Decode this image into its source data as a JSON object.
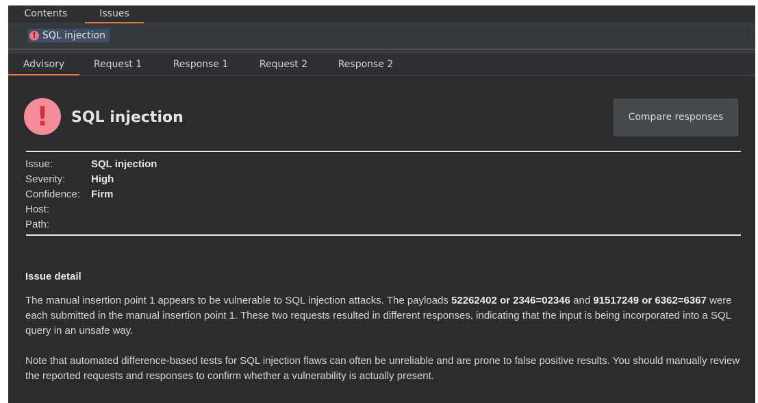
{
  "top_tabs": [
    {
      "label": "Contents",
      "active": false
    },
    {
      "label": "Issues",
      "active": true
    }
  ],
  "selected_issue": {
    "label": "SQL injection",
    "icon": "alert-icon"
  },
  "sub_tabs": [
    {
      "label": "Advisory",
      "active": true
    },
    {
      "label": "Request 1",
      "active": false
    },
    {
      "label": "Response 1",
      "active": false
    },
    {
      "label": "Request 2",
      "active": false
    },
    {
      "label": "Response 2",
      "active": false
    }
  ],
  "advisory": {
    "title": "SQL injection",
    "compare_button": "Compare responses",
    "meta": [
      {
        "key": "Issue:",
        "value": "SQL injection"
      },
      {
        "key": "Severity:",
        "value": "High"
      },
      {
        "key": "Confidence:",
        "value": "Firm"
      },
      {
        "key": "Host:",
        "value": ""
      },
      {
        "key": "Path:",
        "value": ""
      }
    ],
    "detail_heading": "Issue detail",
    "detail_p1": {
      "t1": "The manual insertion point 1 appears to be vulnerable to SQL injection attacks. The payloads ",
      "b1": "52262402 or 2346=02346",
      "t2": " and ",
      "b2": "91517249 or 6362=6367",
      "t3": " were each submitted in the manual insertion point 1. These two requests resulted in different responses, indicating that the input is being incorporated into a SQL query in an unsafe way."
    },
    "detail_p2": "Note that automated difference-based tests for SQL injection flaws can often be unreliable and are prone to false positive results. You should manually review the reported requests and responses to confirm whether a vulnerability is actually present."
  },
  "colors": {
    "background": "#2b2c2e",
    "accent": "#e8783a",
    "severity_icon": "#f48b98",
    "chip_selected": "#3e4f66"
  }
}
